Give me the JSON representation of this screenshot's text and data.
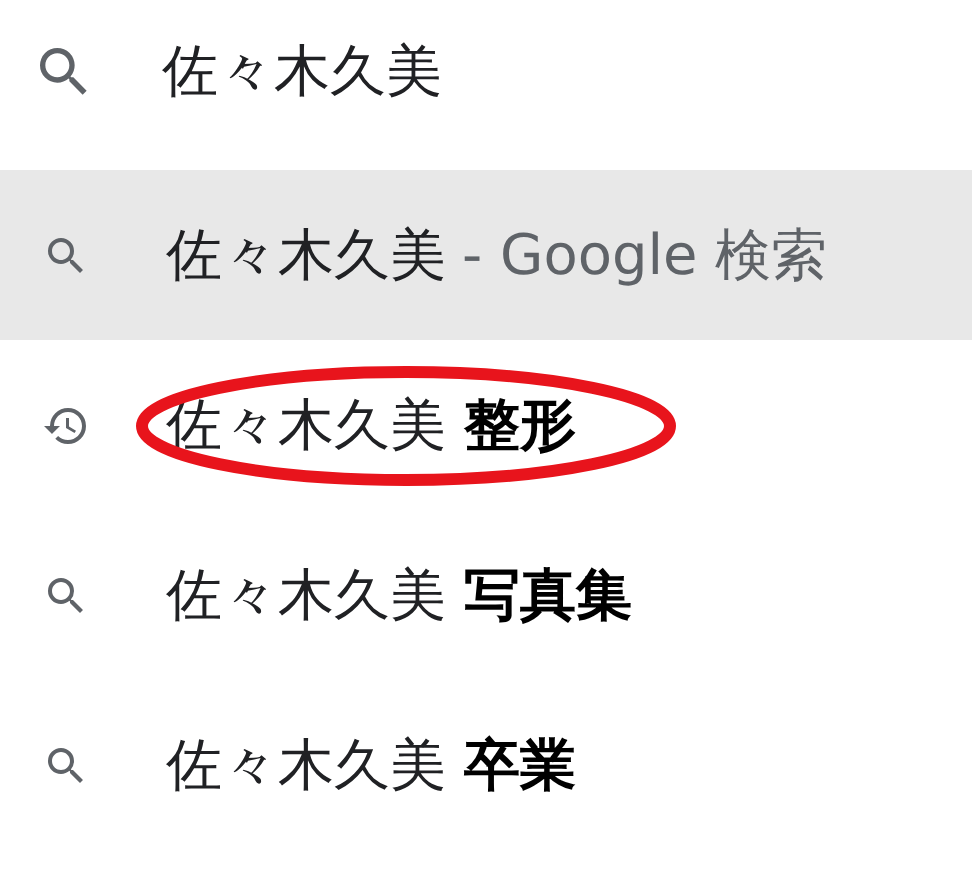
{
  "search": {
    "value": "佐々木久美"
  },
  "suggestions": [
    {
      "kind": "search",
      "text": "佐々木久美",
      "suffix": "- Google 検索",
      "selected": true,
      "circled": false
    },
    {
      "kind": "history",
      "text": "佐々木久美 **整形**",
      "selected": false,
      "circled": true
    },
    {
      "kind": "search",
      "text": "佐々木久美 **写真集**",
      "selected": false,
      "circled": false
    },
    {
      "kind": "search",
      "text": "佐々木久美 **卒業**",
      "selected": false,
      "circled": false
    }
  ]
}
